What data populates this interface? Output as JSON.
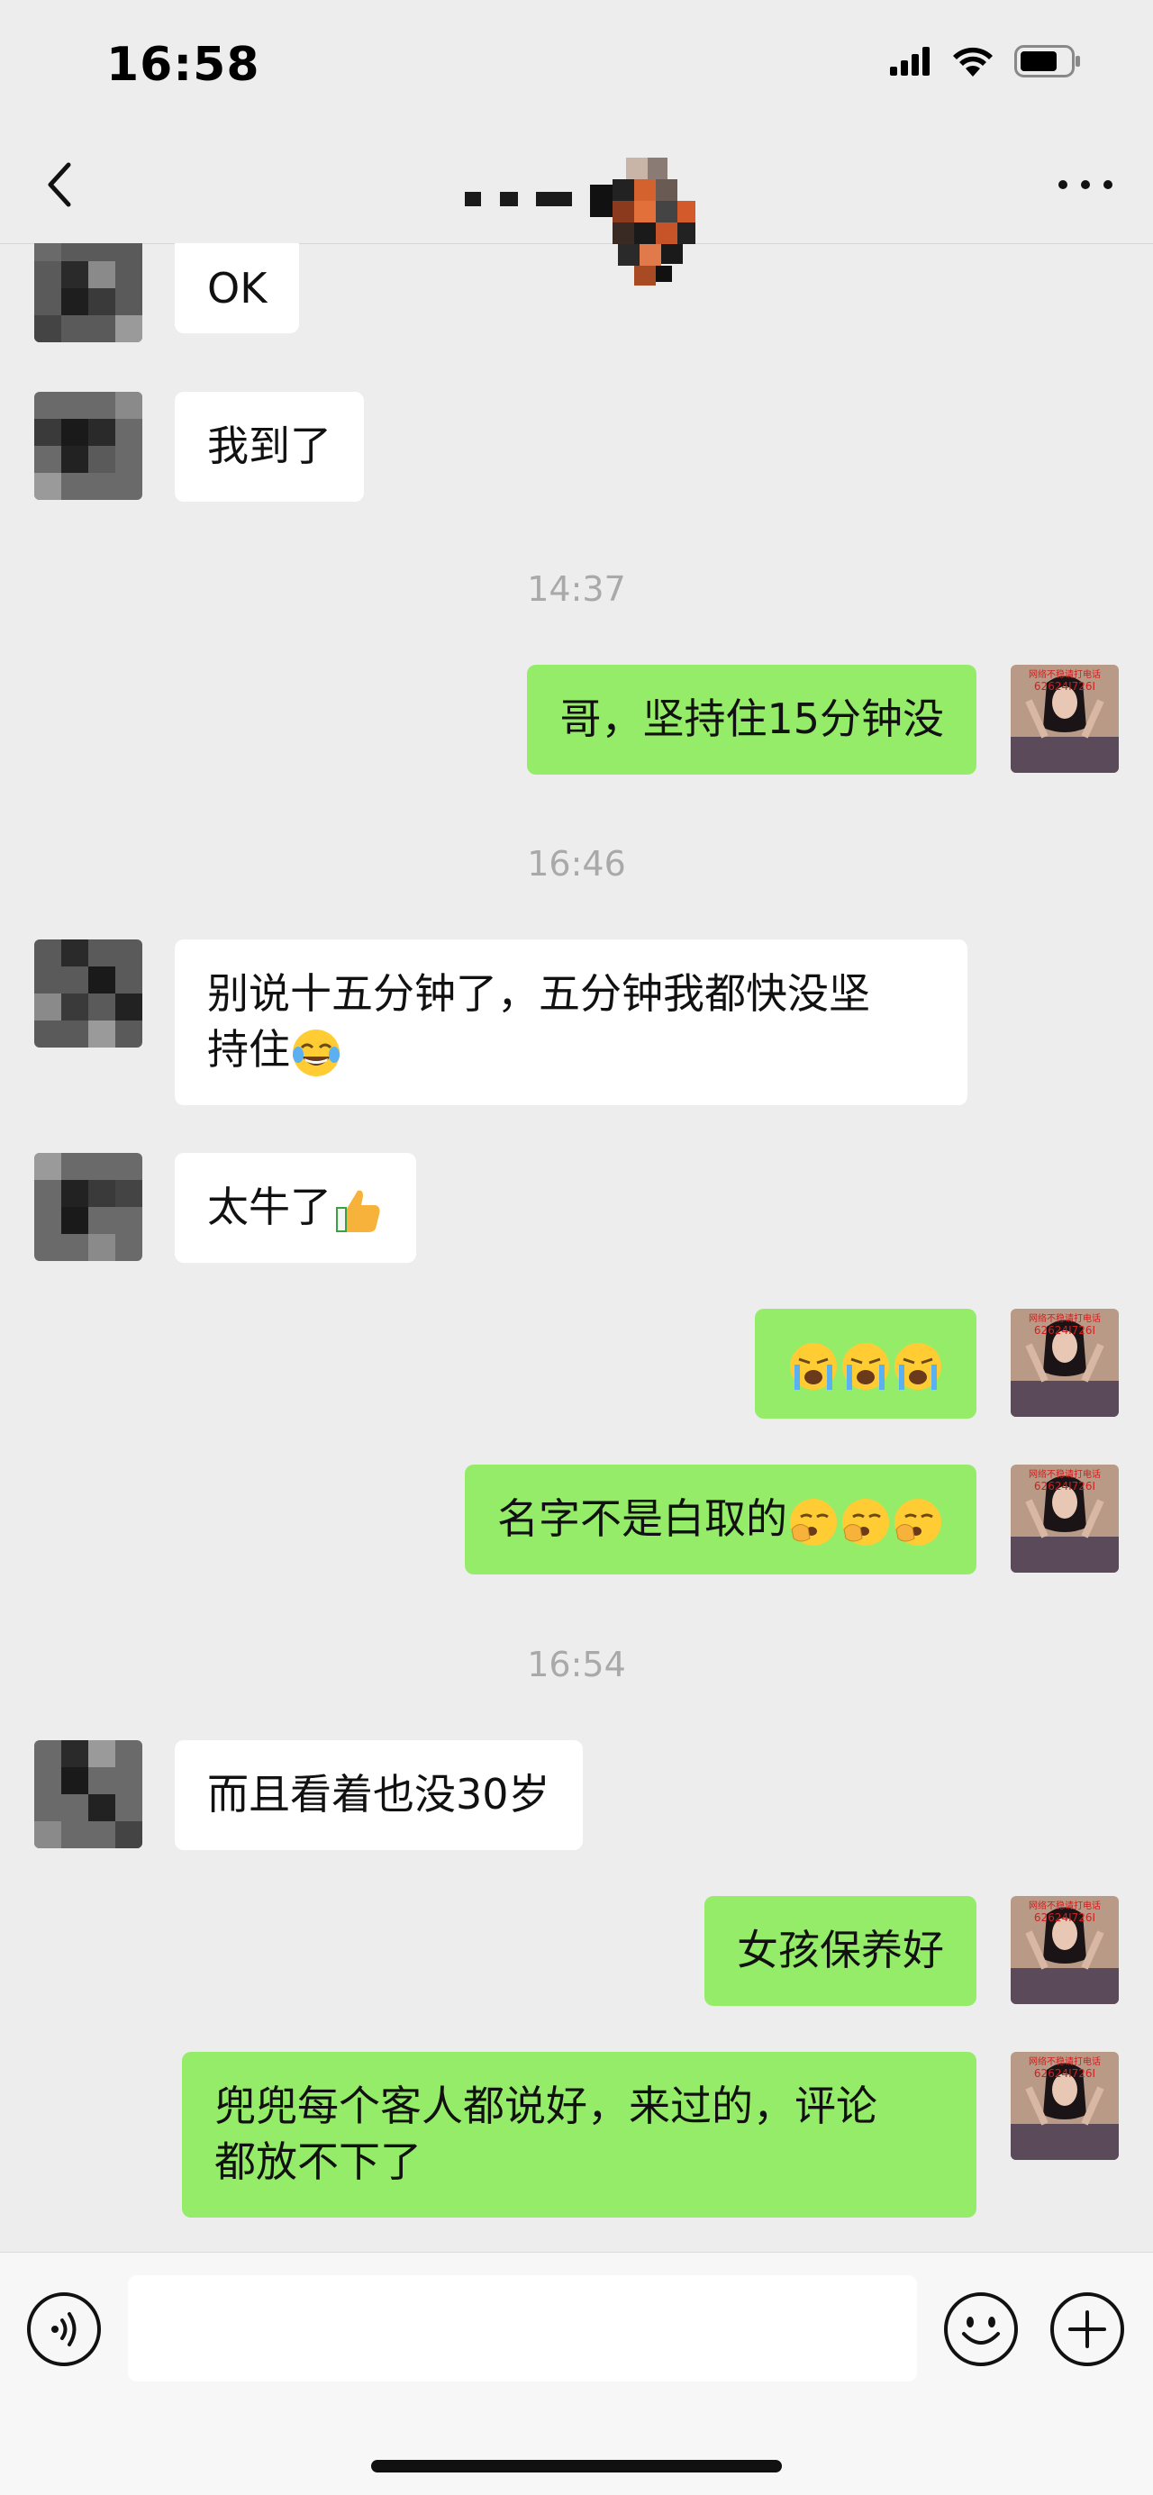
{
  "status_bar": {
    "time": "16:58",
    "icons": [
      "signal-icon",
      "wifi-icon",
      "battery-icon"
    ]
  },
  "nav": {
    "back_icon": "chevron-left-icon",
    "more_icon": "more-icon",
    "title_obscured": true
  },
  "messages": [
    {
      "type": "message",
      "side": "in",
      "text": "OK"
    },
    {
      "type": "message",
      "side": "in",
      "text": "我到了"
    },
    {
      "type": "timestamp",
      "text": "14:37"
    },
    {
      "type": "message",
      "side": "out",
      "text": "哥，坚持住15分钟没"
    },
    {
      "type": "timestamp",
      "text": "16:46"
    },
    {
      "type": "message",
      "side": "in",
      "text_line1": "别说十五分钟了，五分钟我都快没坚",
      "text_line2": "持住",
      "emoji": [
        "tears-of-joy"
      ]
    },
    {
      "type": "message",
      "side": "in",
      "text": "太牛了",
      "emoji": [
        "thumbs-up"
      ]
    },
    {
      "type": "message",
      "side": "out",
      "text": "",
      "emoji": [
        "loudly-crying",
        "loudly-crying",
        "loudly-crying"
      ]
    },
    {
      "type": "message",
      "side": "out",
      "text": "名字不是白取的",
      "emoji": [
        "yawning",
        "yawning",
        "yawning"
      ]
    },
    {
      "type": "timestamp",
      "text": "16:54"
    },
    {
      "type": "message",
      "side": "in",
      "text": "而且看着也没30岁"
    },
    {
      "type": "message",
      "side": "out",
      "text": "女孩保养好"
    },
    {
      "type": "message",
      "side": "out",
      "text_line1": "兜兜每个客人都说好，来过的，评论",
      "text_line2": "都放不下了"
    }
  ],
  "avatar_overlay_text": "62624I726I",
  "input_bar": {
    "input_value": "",
    "icons": [
      "voice-icon",
      "emoji-icon",
      "plus-icon"
    ]
  },
  "colors": {
    "background": "#ededed",
    "outgoing_bubble": "#95ec69",
    "incoming_bubble": "#ffffff",
    "timestamp_text": "#a9a9a9"
  }
}
